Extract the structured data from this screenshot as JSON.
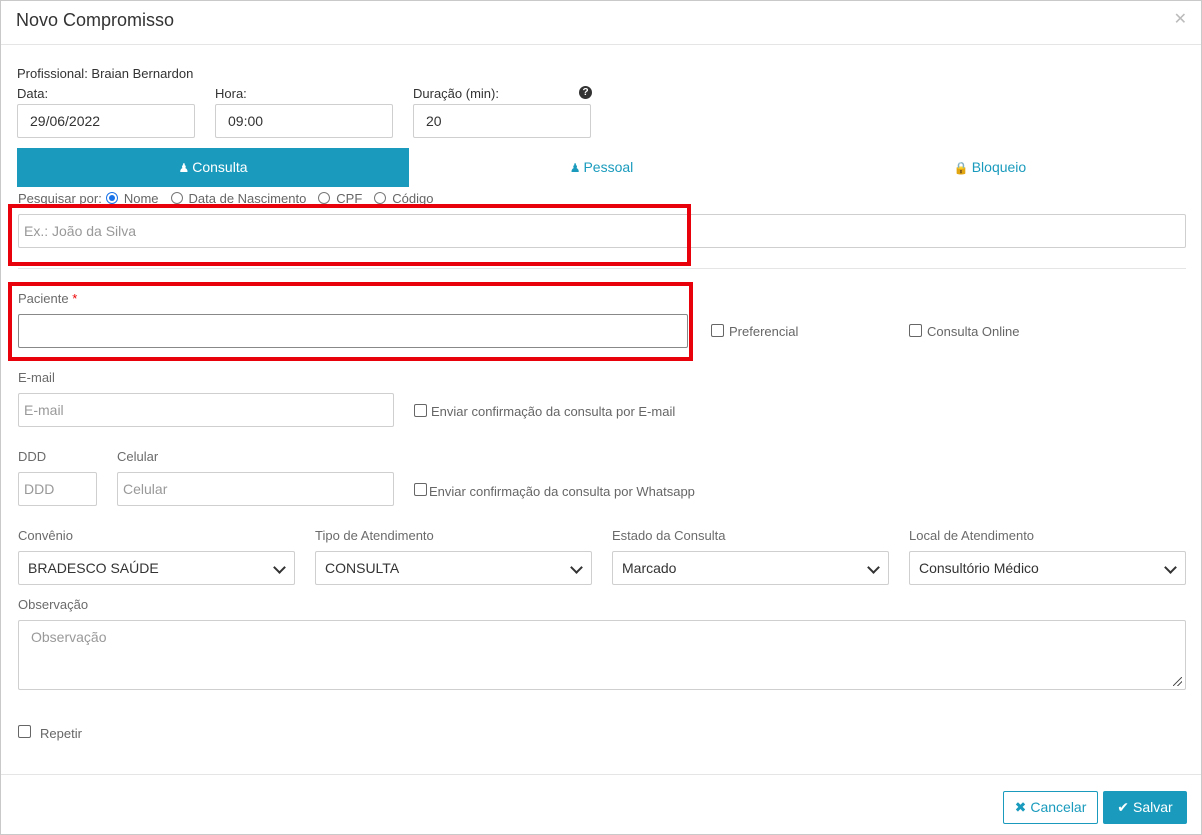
{
  "dialog": {
    "title": "Novo Compromisso",
    "close_icon": "close-icon"
  },
  "professional": "Profissional: Braian Bernardon",
  "date": {
    "label": "Data:",
    "value": "29/06/2022"
  },
  "time": {
    "label": "Hora:",
    "value": "09:00"
  },
  "duration": {
    "label": "Duração (min):",
    "value": "20",
    "help_icon": "question-circle-icon"
  },
  "tabs": [
    {
      "label": "Consulta",
      "icon": "user-md-icon",
      "active": true
    },
    {
      "label": "Pessoal",
      "icon": "user-icon",
      "active": false
    },
    {
      "label": "Bloqueio",
      "icon": "lock-icon",
      "active": false
    }
  ],
  "search": {
    "by_label": "Pesquisar por:",
    "options": [
      "Nome",
      "Data de Nascimento",
      "CPF",
      "Código"
    ],
    "selected": "Nome",
    "placeholder": "Ex.: João da Silva"
  },
  "patient": {
    "label": "Paciente",
    "required_mark": "*",
    "value": ""
  },
  "preferencial_label": "Preferencial",
  "online_label": "Consulta Online",
  "email": {
    "label": "E-mail",
    "placeholder": "E-mail",
    "confirm_label": "Enviar confirmação da consulta por E-mail"
  },
  "phone": {
    "ddd_label": "DDD",
    "ddd_placeholder": "DDD",
    "cell_label": "Celular",
    "cell_placeholder": "Celular",
    "confirm_label": "Enviar confirmação da consulta por Whatsapp"
  },
  "selects": [
    {
      "label": "Convênio",
      "value": "BRADESCO SAÚDE"
    },
    {
      "label": "Tipo de Atendimento",
      "value": "CONSULTA"
    },
    {
      "label": "Estado da Consulta",
      "value": "Marcado"
    },
    {
      "label": "Local de Atendimento",
      "value": "Consultório Médico"
    }
  ],
  "observation": {
    "label": "Observação",
    "placeholder": "Observação"
  },
  "repeat_label": "Repetir",
  "buttons": {
    "cancel": "Cancelar",
    "save": "Salvar"
  },
  "colors": {
    "accent": "#1a9bbd",
    "highlight_box": "#e8000b"
  }
}
